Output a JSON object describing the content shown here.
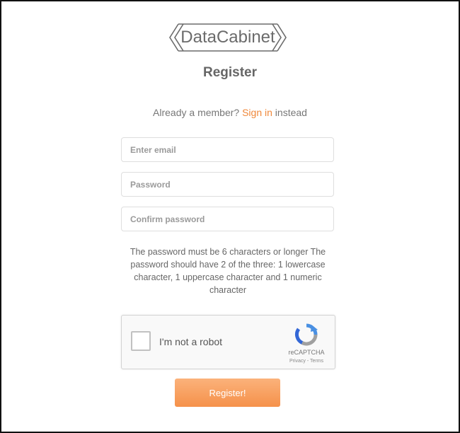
{
  "brand": {
    "name": "DataCabinet"
  },
  "page": {
    "title": "Register"
  },
  "signin": {
    "prefix": "Already a member? ",
    "link_label": "Sign in",
    "suffix": " instead"
  },
  "form": {
    "email": {
      "placeholder": "Enter email",
      "value": ""
    },
    "password": {
      "placeholder": "Password",
      "value": ""
    },
    "confirm": {
      "placeholder": "Confirm password",
      "value": ""
    },
    "hint": "The password must be 6 characters or longer The password should have 2 of the three: 1 lowercase character, 1 uppercase character and 1 numeric character"
  },
  "captcha": {
    "label": "I'm not a robot",
    "brand": "reCAPTCHA",
    "links": "Privacy - Terms",
    "checked": false
  },
  "submit": {
    "label": "Register!"
  },
  "colors": {
    "accent": "#f0883a",
    "button": "#f5914a",
    "text": "#666666"
  }
}
